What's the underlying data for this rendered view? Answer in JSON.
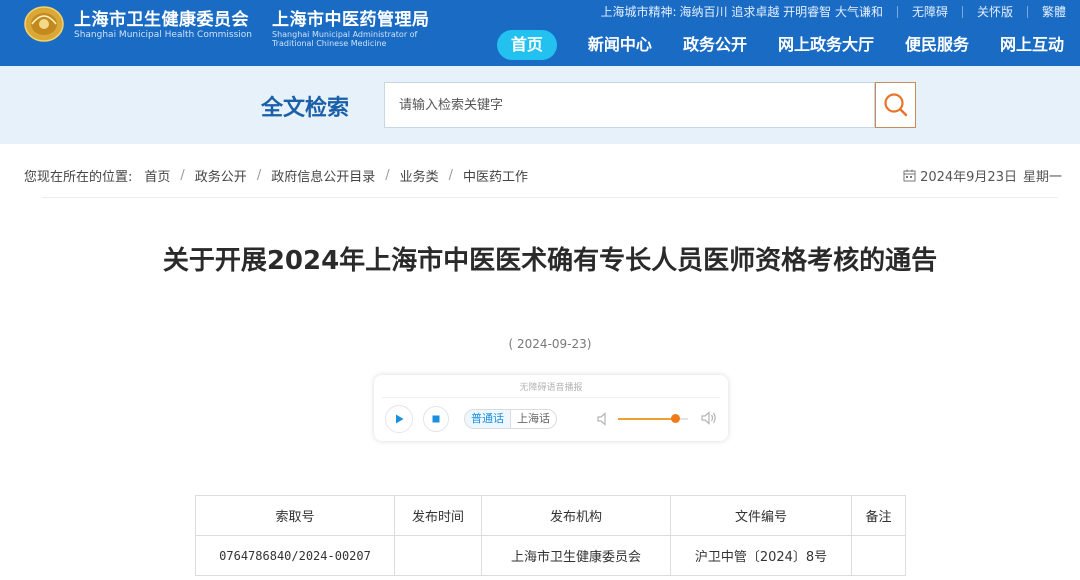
{
  "header": {
    "org1_cn": "上海市卫生健康委员会",
    "org1_en": "Shanghai Municipal Health Commission",
    "org2_cn": "上海市中医药管理局",
    "org2_en": "Shanghai Municipal Administrator of Traditional Chinese Medicine",
    "brand_color": "#1a6bc4",
    "topbar": {
      "spirit_label": "上海城市精神:",
      "spirit_text": "海纳百川 追求卓越 开明睿智 大气谦和",
      "accessibility": "无障碍",
      "care_mode": "关怀版",
      "traditional": "繁體"
    },
    "nav": [
      "首页",
      "新闻中心",
      "政务公开",
      "网上政务大厅",
      "便民服务",
      "网上互动"
    ],
    "nav_active_color": "#22c1f0"
  },
  "search": {
    "title": "全文检索",
    "placeholder": "请输入检索关键字",
    "button_icon": "search-icon"
  },
  "breadcrumb": {
    "label": "您现在所在的位置:",
    "items": [
      "首页",
      "政务公开",
      "政府信息公开目录",
      "业务类",
      "中医药工作"
    ]
  },
  "date": {
    "icon": "calendar-icon",
    "text": "2024年9月23日",
    "weekday": "星期一"
  },
  "article": {
    "title": "关于开展2024年上海市中医医术确有专长人员医师资格考核的通告",
    "date": "( 2024-09-23)"
  },
  "player": {
    "caption": "无障碍语音播报",
    "dialects": [
      "普通话",
      "上海话"
    ],
    "volume": 0.82
  },
  "table": {
    "headers": [
      "索取号",
      "发布时间",
      "发布机构",
      "文件编号",
      "备注"
    ],
    "rows": [
      [
        "0764786840/2024-00207",
        "",
        "上海市卫生健康委员会",
        "沪卫中管〔2024〕8号",
        ""
      ]
    ]
  }
}
